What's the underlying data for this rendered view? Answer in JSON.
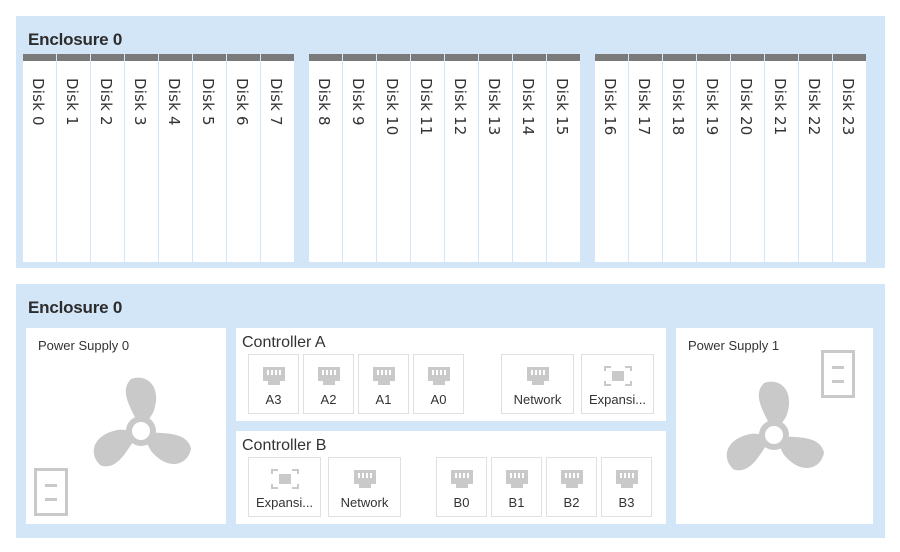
{
  "front_enclosure": {
    "title": "Enclosure 0",
    "disks": [
      "Disk 0",
      "Disk 1",
      "Disk 2",
      "Disk 3",
      "Disk 4",
      "Disk 5",
      "Disk 6",
      "Disk 7",
      "Disk 8",
      "Disk 9",
      "Disk 10",
      "Disk 11",
      "Disk 12",
      "Disk 13",
      "Disk 14",
      "Disk 15",
      "Disk 16",
      "Disk 17",
      "Disk 18",
      "Disk 19",
      "Disk 20",
      "Disk 21",
      "Disk 22",
      "Disk 23"
    ]
  },
  "rear_enclosure": {
    "title": "Enclosure 0",
    "power_supply_0": {
      "label": "Power Supply 0",
      "icons": [
        "fan-icon",
        "power-supply-icon"
      ]
    },
    "power_supply_1": {
      "label": "Power Supply 1",
      "icons": [
        "fan-icon",
        "power-supply-icon"
      ]
    },
    "controller_a": {
      "title": "Controller A",
      "ports": [
        "A3",
        "A2",
        "A1",
        "A0"
      ],
      "network_label": "Network",
      "expansion_label": "Expansi..."
    },
    "controller_b": {
      "title": "Controller B",
      "expansion_label": "Expansi...",
      "network_label": "Network",
      "ports": [
        "B0",
        "B1",
        "B2",
        "B3"
      ]
    }
  },
  "colors": {
    "panel_bg": "#d3e6f7",
    "disk_top_bar": "#7a7a7a",
    "icon_gray": "#c9c9c9"
  }
}
